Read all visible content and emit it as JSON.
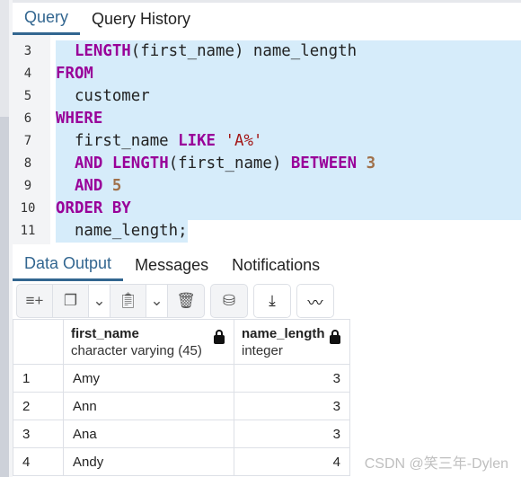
{
  "editor_tabs": [
    "Query",
    "Query History"
  ],
  "code_lines": [
    {
      "n": "3",
      "indent": "  ",
      "parts": [
        [
          "kw",
          "LENGTH"
        ],
        [
          "",
          "(first_name) name_length"
        ]
      ]
    },
    {
      "n": "4",
      "indent": "",
      "parts": [
        [
          "kw",
          "FROM"
        ]
      ]
    },
    {
      "n": "5",
      "indent": "  ",
      "parts": [
        [
          "",
          "customer"
        ]
      ]
    },
    {
      "n": "6",
      "indent": "",
      "parts": [
        [
          "kw",
          "WHERE"
        ]
      ]
    },
    {
      "n": "7",
      "indent": "  ",
      "parts": [
        [
          "",
          "first_name "
        ],
        [
          "kw",
          "LIKE"
        ],
        [
          "",
          " "
        ],
        [
          "str",
          "'A%'"
        ]
      ]
    },
    {
      "n": "8",
      "indent": "  ",
      "parts": [
        [
          "kw",
          "AND"
        ],
        [
          "",
          " "
        ],
        [
          "kw",
          "LENGTH"
        ],
        [
          "",
          "(first_name) "
        ],
        [
          "kw",
          "BETWEEN"
        ],
        [
          "",
          " "
        ],
        [
          "num",
          "3"
        ]
      ]
    },
    {
      "n": "9",
      "indent": "  ",
      "parts": [
        [
          "kw",
          "AND"
        ],
        [
          "",
          " "
        ],
        [
          "num",
          "5"
        ]
      ]
    },
    {
      "n": "10",
      "indent": "",
      "parts": [
        [
          "kw",
          "ORDER BY"
        ]
      ]
    },
    {
      "n": "11",
      "indent": "  ",
      "parts": [
        [
          "",
          "name_length;"
        ]
      ]
    }
  ],
  "output_tabs": [
    "Data Output",
    "Messages",
    "Notifications"
  ],
  "toolbar_icons": [
    "add-row-icon",
    "copy-icon",
    "chevron-down-icon",
    "paste-icon",
    "chevron-down-icon",
    "delete-icon",
    "save-data-icon",
    "download-icon",
    "graph-icon"
  ],
  "columns": [
    {
      "name": "first_name",
      "type": "character varying (45)"
    },
    {
      "name": "name_length",
      "type": "integer"
    }
  ],
  "rows": [
    [
      "1",
      "Amy",
      "3"
    ],
    [
      "2",
      "Ann",
      "3"
    ],
    [
      "3",
      "Ana",
      "3"
    ],
    [
      "4",
      "Andy",
      "4"
    ]
  ],
  "watermark": "CSDN @笑三年-Dylen",
  "colors": {
    "accent": "#326690",
    "keyword": "#990099",
    "selection": "#d6ecfa"
  }
}
